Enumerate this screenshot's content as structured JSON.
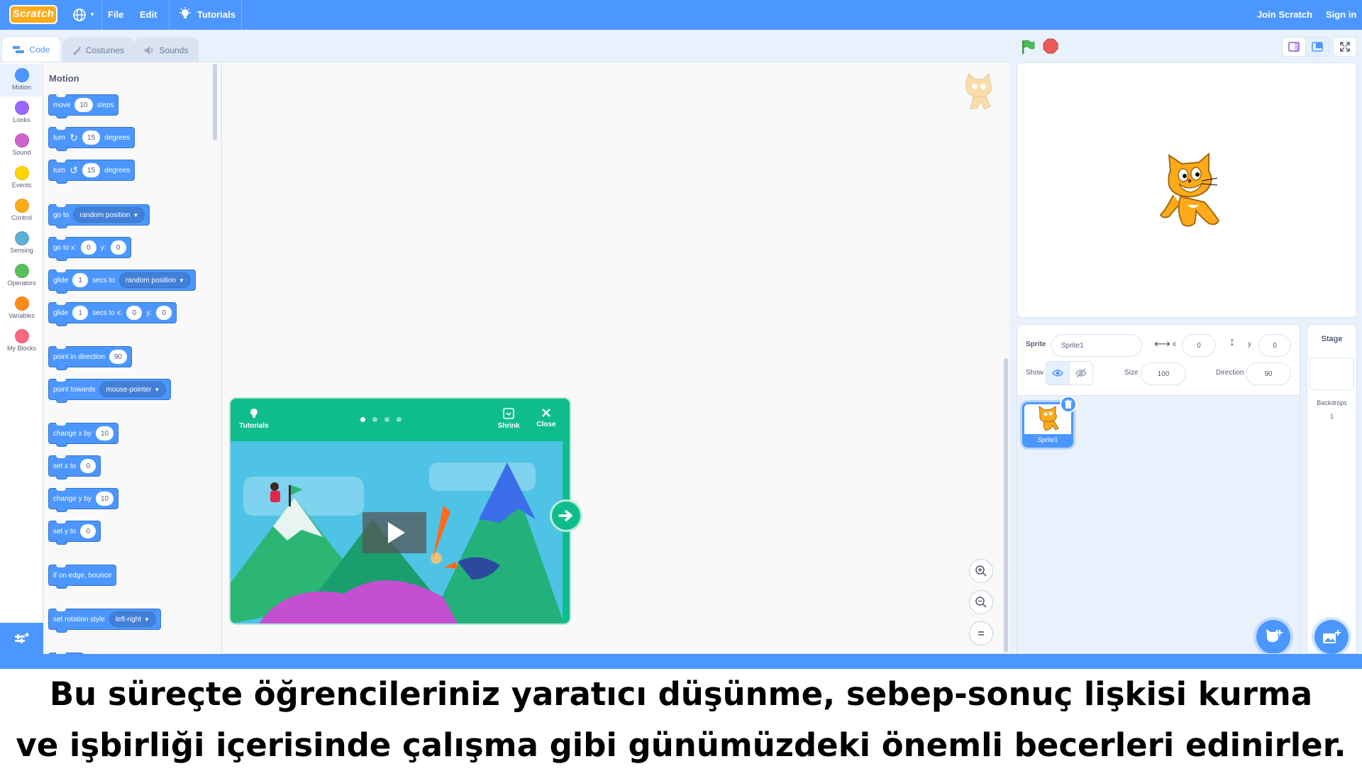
{
  "menubar": {
    "logo_text": "Scratch",
    "file": "File",
    "edit": "Edit",
    "tutorials": "Tutorials",
    "join": "Join Scratch",
    "signin": "Sign in"
  },
  "tabs": [
    {
      "label": "Code"
    },
    {
      "label": "Costumes"
    },
    {
      "label": "Sounds"
    }
  ],
  "categories": [
    {
      "label": "Motion",
      "color": "#4c97ff"
    },
    {
      "label": "Looks",
      "color": "#9966ff"
    },
    {
      "label": "Sound",
      "color": "#cf63cf"
    },
    {
      "label": "Events",
      "color": "#ffd500"
    },
    {
      "label": "Control",
      "color": "#ffab19"
    },
    {
      "label": "Sensing",
      "color": "#5cb1d6"
    },
    {
      "label": "Operators",
      "color": "#59c059"
    },
    {
      "label": "Variables",
      "color": "#ff8c1a"
    },
    {
      "label": "My Blocks",
      "color": "#ff6680"
    }
  ],
  "palette": {
    "title": "Motion",
    "blocks": {
      "move": {
        "t1": "move",
        "v1": "10",
        "t2": "steps"
      },
      "turn_right": {
        "t1": "turn",
        "v1": "15",
        "t2": "degrees"
      },
      "turn_left": {
        "t1": "turn",
        "v1": "15",
        "t2": "degrees"
      },
      "goto": {
        "t1": "go to",
        "dd": "random position"
      },
      "goto_xy": {
        "t1": "go to x:",
        "v1": "0",
        "t2": "y:",
        "v2": "0"
      },
      "glide_to": {
        "t1": "glide",
        "v1": "1",
        "t2": "secs to",
        "dd": "random position"
      },
      "glide_xy": {
        "t1": "glide",
        "v1": "1",
        "t2": "secs to x:",
        "v2": "0",
        "t3": "y:",
        "v3": "0"
      },
      "point_dir": {
        "t1": "point in direction",
        "v1": "90"
      },
      "point_towards": {
        "t1": "point towards",
        "dd": "mouse-pointer"
      },
      "change_x": {
        "t1": "change x by",
        "v1": "10"
      },
      "set_x": {
        "t1": "set x to",
        "v1": "0"
      },
      "change_y": {
        "t1": "change y by",
        "v1": "10"
      },
      "set_y": {
        "t1": "set y to",
        "v1": "0"
      },
      "bounce": {
        "t1": "if on edge, bounce"
      },
      "rotation": {
        "t1": "set rotation style",
        "dd": "left-right"
      }
    }
  },
  "tutorial": {
    "title": "Tutorials",
    "shrink": "Shrink",
    "close": "Close",
    "steps_total": 4,
    "current_step": 1
  },
  "sprite_info": {
    "sprite_label": "Sprite",
    "sprite_name": "Sprite1",
    "x_label": "x",
    "x_value": "0",
    "y_label": "y",
    "y_value": "0",
    "show_label": "Show",
    "size_label": "Size",
    "size_value": "100",
    "direction_label": "Direction",
    "direction_value": "90"
  },
  "sprites": [
    {
      "name": "Sprite1"
    }
  ],
  "stage_pane": {
    "title": "Stage",
    "backdrops_label": "Backdrops",
    "backdrops_count": "1"
  },
  "caption": {
    "line1": "Bu süreçte öğrencileriniz yaratıcı düşünme, sebep-sonuç lişkisi kurma",
    "line2": "ve işbirliği içerisinde çalışma gibi günümüzdeki önemli becerleri edinirler."
  }
}
